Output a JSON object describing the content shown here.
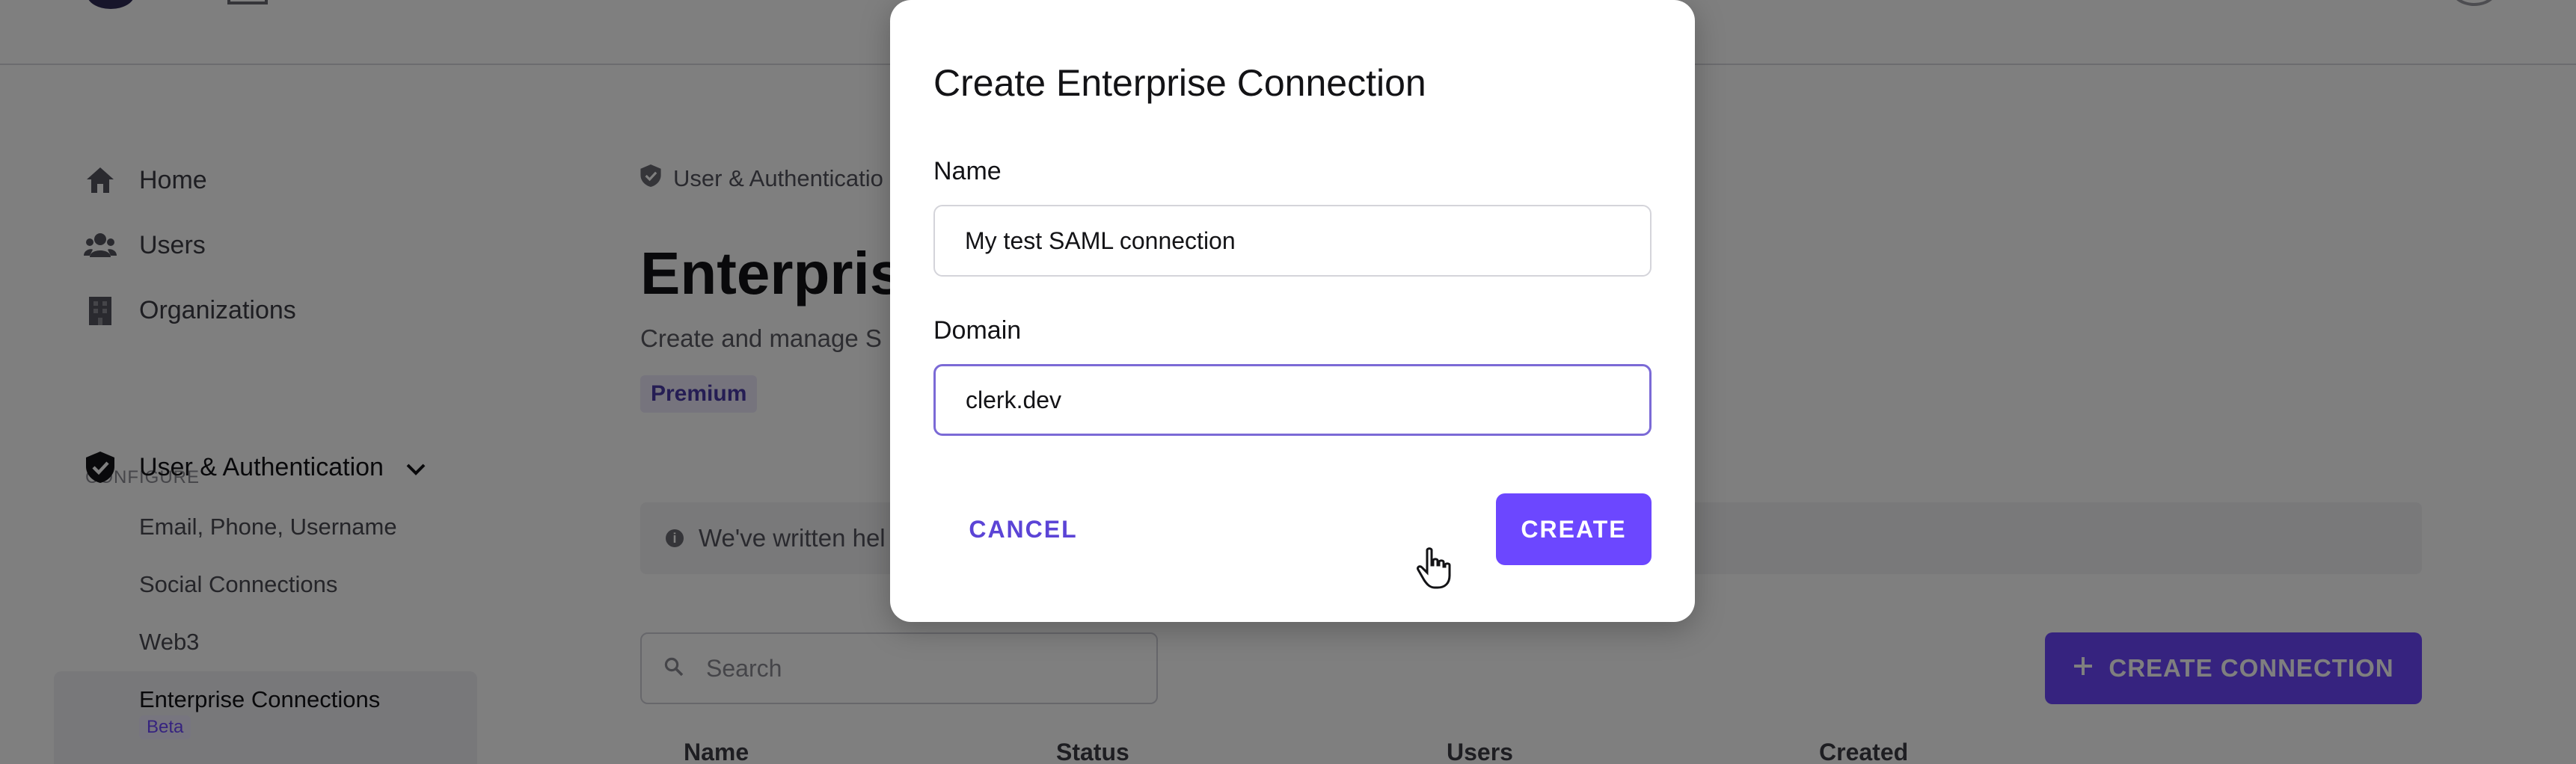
{
  "sidebar": {
    "nav_items": [
      {
        "label": "Home",
        "icon": "home-icon"
      },
      {
        "label": "Users",
        "icon": "users-icon"
      },
      {
        "label": "Organizations",
        "icon": "building-icon"
      }
    ],
    "section_label": "CONFIGURE",
    "group": {
      "label": "User & Authentication",
      "icon": "shield-check-icon",
      "expand_icon": "chevron-down-icon"
    },
    "sub_items": [
      {
        "label": "Email, Phone, Username"
      },
      {
        "label": "Social Connections"
      },
      {
        "label": "Web3"
      },
      {
        "label": "Enterprise Connections",
        "badge": "Beta",
        "active": true
      }
    ]
  },
  "main": {
    "breadcrumb": "User & Authenticatio",
    "title": "Enterpris",
    "subtitle": "Create and manage S",
    "premium_badge": "Premium",
    "info_banner": "We've written hel",
    "search": {
      "placeholder": "Search"
    },
    "create_connection_label": "CREATE CONNECTION",
    "table_headers": [
      "Name",
      "Status",
      "Users",
      "Created"
    ]
  },
  "modal": {
    "title": "Create Enterprise Connection",
    "name_label": "Name",
    "name_value": "My test SAML connection",
    "domain_label": "Domain",
    "domain_value": "clerk.dev",
    "cancel_label": "CANCEL",
    "create_label": "CREATE"
  },
  "colors": {
    "accent": "#6c47ff",
    "overlay": "rgba(0,0,0,0.5)"
  }
}
